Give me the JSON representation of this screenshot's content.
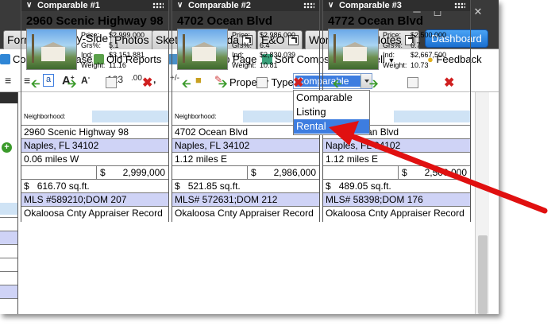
{
  "tabs": [
    {
      "label": "Forms",
      "active": false,
      "external": false
    },
    {
      "label": "Side-by-Side",
      "active": true,
      "external": false
    },
    {
      "label": "Photos",
      "active": false,
      "external": false
    },
    {
      "label": "Sketch",
      "active": false,
      "external": false
    },
    {
      "label": "Addenda",
      "active": false,
      "external": true
    },
    {
      "label": "E&O",
      "active": false,
      "external": true
    },
    {
      "label": "Workfile",
      "active": false,
      "external": true
    },
    {
      "label": "Notes",
      "active": false,
      "external": true
    }
  ],
  "dashboard_label": "Dashboard",
  "toolbar1": {
    "comps_database": "Comps Database",
    "old_reports": "Old Reports",
    "add_comp_page": "Add Comp Page",
    "sort_comps": "Sort Comps",
    "spell": "Spell",
    "feedback": "Feedback"
  },
  "toolbar2": {
    "num_format": "123",
    "dec_format": ".00",
    "comma_format": ",",
    "sign_format": "+/-",
    "property_type_label": "Property Type:",
    "property_type_value": "Comparable",
    "options": [
      "Comparable",
      "Listing",
      "Rental"
    ],
    "highlighted_option": "Rental"
  },
  "neighborhood_label": "Neighborhood:",
  "comps": [
    {
      "header": "Comparable #1",
      "address": "2960 Scenic Highway 98",
      "price": "$2,999,000",
      "grs": "5.1",
      "ind": "$3,151,881",
      "weight": "11.16",
      "street": "2960 Scenic Highway 98",
      "city": "Naples, FL 34102",
      "distance": "0.06 miles W",
      "sale_price": "2,999,000",
      "price_per_sqft": "616.70",
      "mls": "MLS #589210;DOM 207",
      "source": "Okaloosa Cnty Appraiser Record"
    },
    {
      "header": "Comparable #2",
      "address": "4702 Ocean Blvd",
      "price": "$2,986,000",
      "grs": "6.4",
      "ind": "$2,830,039",
      "weight": "10.81",
      "street": "4702 Ocean Blvd",
      "city": "Naples, FL 34102",
      "distance": "1.12 miles E",
      "sale_price": "2,986,000",
      "price_per_sqft": "521.85",
      "mls": "MLS# 572631;DOM 212",
      "source": "Okaloosa Cnty Appraiser Record"
    },
    {
      "header": "Comparable #3",
      "address": "4772 Ocean Blvd",
      "price": "$2,500,000",
      "grs": "6.7",
      "ind": "$2,667,500",
      "weight": "10.73",
      "street": "4772 Ocean Blvd",
      "city": "Naples, FL 34102",
      "distance": "1.12 miles E",
      "sale_price": "2,500,000",
      "price_per_sqft": "489.05",
      "mls": "MLS# 58398;DOM 176",
      "source": "Okaloosa Cnty Appraiser Record"
    }
  ],
  "labels": {
    "price": "Price:",
    "grs": "Grs%:",
    "ind": "Ind:",
    "weight": "Weight:",
    "currency": "$",
    "sqft": "sq.ft."
  },
  "colors": {
    "accent_blue": "#3d7de0",
    "row_blue": "#cfd3f6",
    "annotation_red": "#e01010"
  }
}
